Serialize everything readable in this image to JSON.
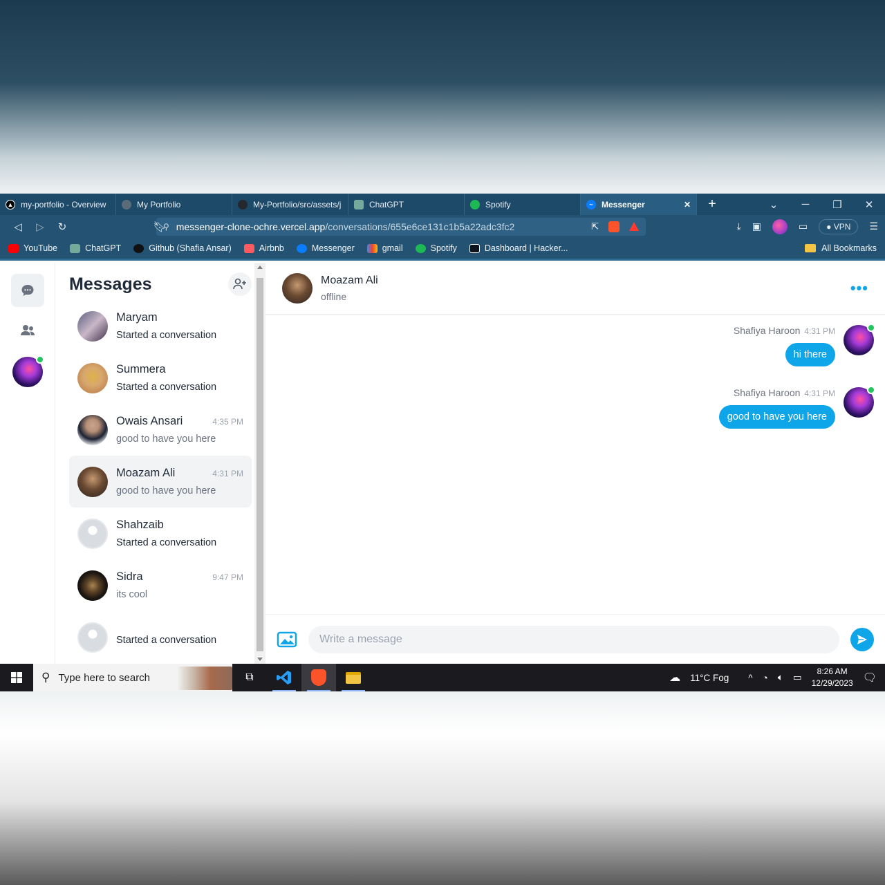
{
  "browser": {
    "tabs": [
      {
        "label": "my-portfolio - Overview",
        "icon": "vercel-icon",
        "color": "#ffffff"
      },
      {
        "label": "My Portfolio",
        "icon": "globe-icon",
        "color": "#9aa5b1"
      },
      {
        "label": "My-Portfolio/src/assets/j",
        "icon": "github-icon",
        "color": "#9aa5b1"
      },
      {
        "label": "ChatGPT",
        "icon": "chatgpt-icon",
        "color": "#74aa9c"
      },
      {
        "label": "Spotify",
        "icon": "spotify-icon",
        "color": "#1db954"
      }
    ],
    "active_tab": {
      "label": "Messenger",
      "icon": "messenger-icon",
      "close": "✕"
    },
    "new_tab": "+",
    "url_host": "messenger-clone-ochre.vercel.app",
    "url_path": "/conversations/655e6ce131c1b5a22adc3fc2",
    "vpn_label": "VPN",
    "bookmarks": [
      {
        "label": "YouTube",
        "color": "#ff0000"
      },
      {
        "label": "ChatGPT",
        "color": "#74aa9c"
      },
      {
        "label": "Github (Shafia Ansar)",
        "color": "#111111"
      },
      {
        "label": "Airbnb",
        "color": "#ff5a5f"
      },
      {
        "label": "Messenger",
        "color": "#0a7cff"
      },
      {
        "label": "gmail",
        "color": "#ea4335"
      },
      {
        "label": "Spotify",
        "color": "#1db954"
      },
      {
        "label": "Dashboard | Hacker...",
        "color": "#0e141e"
      }
    ],
    "all_bookmarks": "All Bookmarks"
  },
  "sidebar": {
    "title": "Messages",
    "conversations": [
      {
        "name": "Maryam",
        "time": "",
        "preview": "Started a conversation",
        "muted": false
      },
      {
        "name": "Summera",
        "time": "",
        "preview": "Started a conversation",
        "muted": false
      },
      {
        "name": "Owais Ansari",
        "time": "4:35 PM",
        "preview": "good to have you here",
        "muted": true
      },
      {
        "name": "Moazam Ali",
        "time": "4:31 PM",
        "preview": "good to have you here",
        "muted": true,
        "selected": true
      },
      {
        "name": "Shahzaib",
        "time": "",
        "preview": "Started a conversation",
        "muted": false
      },
      {
        "name": "Sidra",
        "time": "9:47 PM",
        "preview": "its cool",
        "muted": true
      },
      {
        "name": "",
        "time": "",
        "preview": "Started a conversation",
        "muted": false
      }
    ]
  },
  "chat": {
    "name": "Moazam Ali",
    "status": "offline",
    "messages": [
      {
        "sender": "Shafiya Haroon",
        "time": "4:31 PM",
        "text": "hi there"
      },
      {
        "sender": "Shafiya Haroon",
        "time": "4:31 PM",
        "text": "good to have you here"
      }
    ],
    "placeholder": "Write a message"
  },
  "taskbar": {
    "search_placeholder": "Type here to search",
    "weather": "11°C  Fog",
    "time": "8:26 AM",
    "date": "12/29/2023"
  },
  "colors": {
    "accent": "#0ea5e9",
    "online": "#22c55e"
  }
}
